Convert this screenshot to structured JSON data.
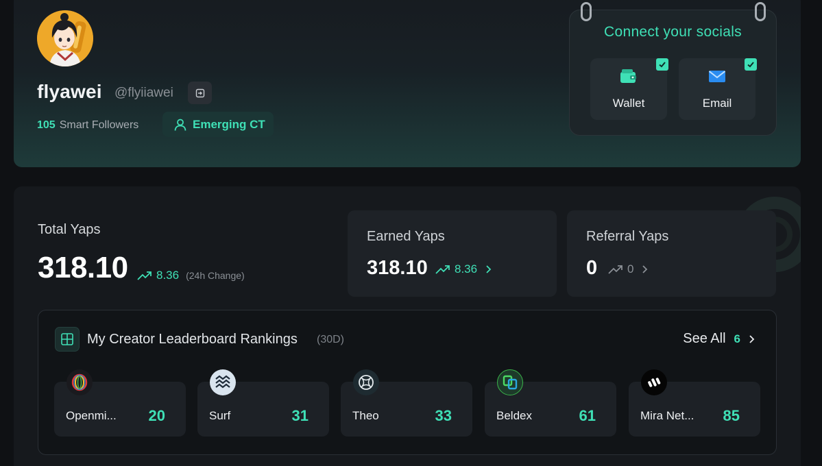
{
  "profile": {
    "display_name": "flyawei",
    "handle": "@flyiiawei",
    "smart_followers_count": "105",
    "smart_followers_label": "Smart Followers",
    "tier": "Emerging CT"
  },
  "socials": {
    "title": "Connect your socials",
    "items": [
      {
        "label": "Wallet",
        "icon": "wallet-icon",
        "connected": true
      },
      {
        "label": "Email",
        "icon": "mail-icon",
        "connected": true
      }
    ]
  },
  "stats": {
    "total_label": "Total Yaps",
    "total_value": "318.10",
    "total_change": "8.36",
    "total_change_note": "(24h Change)",
    "earned": {
      "label": "Earned Yaps",
      "value": "318.10",
      "change": "8.36"
    },
    "referral": {
      "label": "Referral Yaps",
      "value": "0",
      "change": "0"
    }
  },
  "leaderboard": {
    "title": "My Creator Leaderboard Rankings",
    "period": "(30D)",
    "see_all_label": "See All",
    "see_all_count": "6",
    "rankings": [
      {
        "name": "Openmi...",
        "rank": "20"
      },
      {
        "name": "Surf",
        "rank": "31"
      },
      {
        "name": "Theo",
        "rank": "33"
      },
      {
        "name": "Beldex",
        "rank": "61"
      },
      {
        "name": "Mira Net...",
        "rank": "85"
      }
    ]
  },
  "colors": {
    "accent": "#3fe0b6",
    "background": "#0f1114",
    "card": "#1e2227"
  }
}
